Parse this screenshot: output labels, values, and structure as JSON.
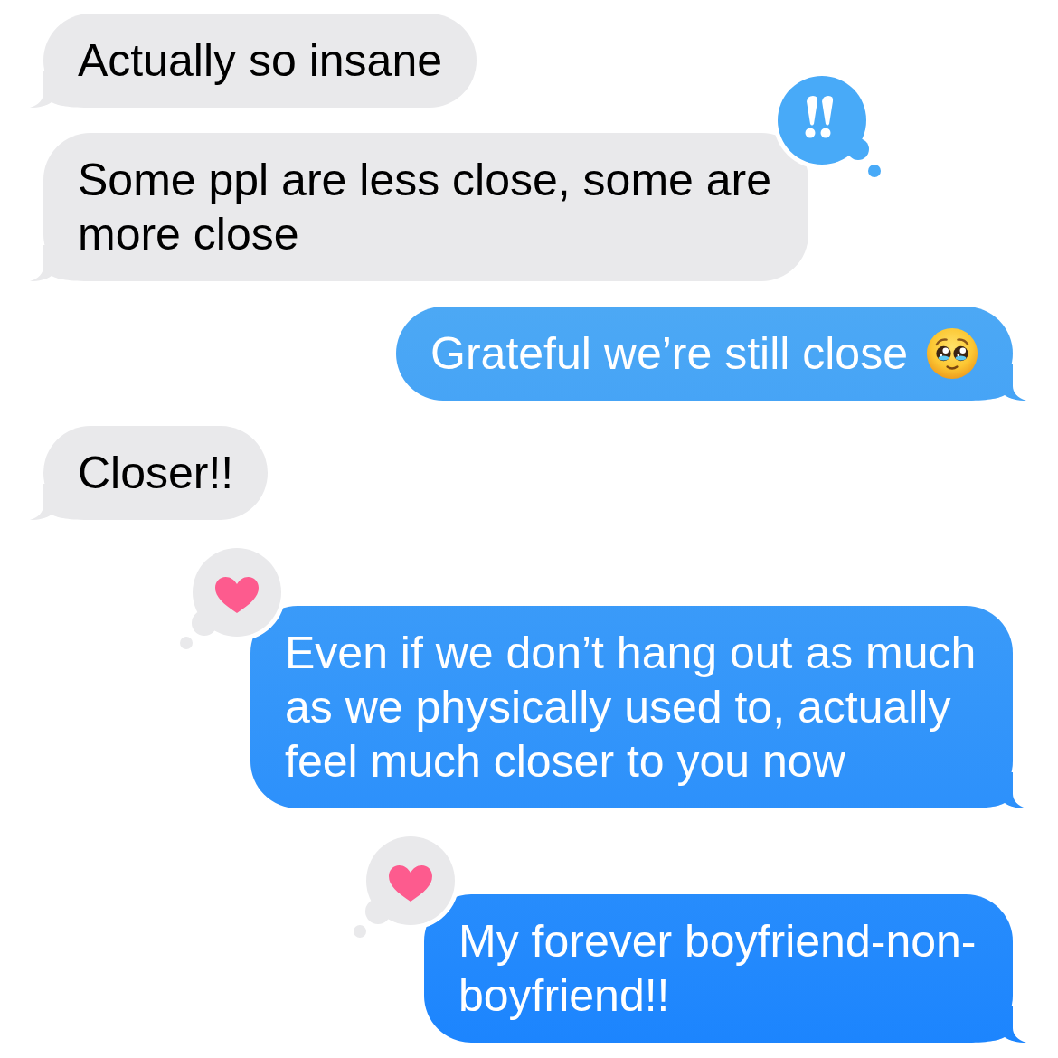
{
  "messages": [
    {
      "kind": "incoming",
      "text": "Actually so insane"
    },
    {
      "kind": "incoming",
      "text": "Some ppl are less close, some are more close",
      "tapback": {
        "kind": "emphasize"
      }
    },
    {
      "kind": "outgoing",
      "text": "Grateful we’re still close",
      "emoji": {
        "kind": "pleading_face"
      }
    },
    {
      "kind": "incoming",
      "text": "Closer!!"
    },
    {
      "kind": "outgoing",
      "text": "Even if we don’t hang out as much as we physically used to, actually feel much closer to you now",
      "tapback": {
        "kind": "heart"
      }
    },
    {
      "kind": "outgoing",
      "text": "My forever boyfriend-non-boyfriend!!",
      "tapback": {
        "kind": "heart"
      }
    }
  ]
}
